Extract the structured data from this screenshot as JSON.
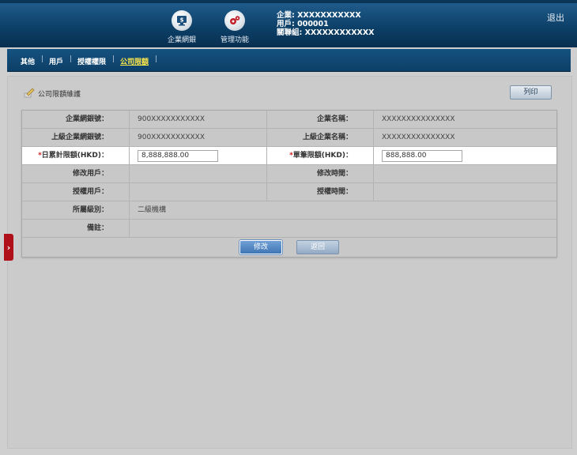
{
  "header": {
    "nav": [
      {
        "label": "企業網銀",
        "icon": "monitor-dollar-icon"
      },
      {
        "label": "管理功能",
        "icon": "gears-icon"
      }
    ],
    "user_info": {
      "company": "企業: XXXXXXXXXXX",
      "user": "用戶: 000001",
      "group": "關聯組: XXXXXXXXXXXX"
    },
    "logout_label": "退出"
  },
  "menu": {
    "items": [
      "其他",
      "用戶",
      "授權權限",
      "公司限額"
    ],
    "active": "公司限額"
  },
  "section": {
    "title": "公司限額維護",
    "print_label": "列印"
  },
  "form": {
    "rows": [
      {
        "l1": "企業網銀號：",
        "v1": "900XXXXXXXXXXX",
        "l2": "企業名稱：",
        "v2": "XXXXXXXXXXXXXXX"
      },
      {
        "l1": "上級企業網銀號：",
        "v1": "900XXXXXXXXXXX",
        "l2": "上級企業名稱：",
        "v2": "XXXXXXXXXXXXXXX"
      },
      {
        "l1": "日累計限額(HKD)：",
        "v1": "8,888,888.00",
        "l2": "單筆限額(HKD)：",
        "v2": "888,888.00"
      },
      {
        "l1": "修改用戶：",
        "v1": "",
        "l2": "修改時間：",
        "v2": ""
      },
      {
        "l1": "授權用戶：",
        "v1": "",
        "l2": "授權時間：",
        "v2": ""
      }
    ],
    "level_label": "所屬級別：",
    "level_value": "二級機構",
    "remark_label": "備註：",
    "remark_value": "",
    "required_mark": "*",
    "modify_label": "修改",
    "back_label": "返回"
  },
  "side_tab_icon": "chevron-right-icon"
}
